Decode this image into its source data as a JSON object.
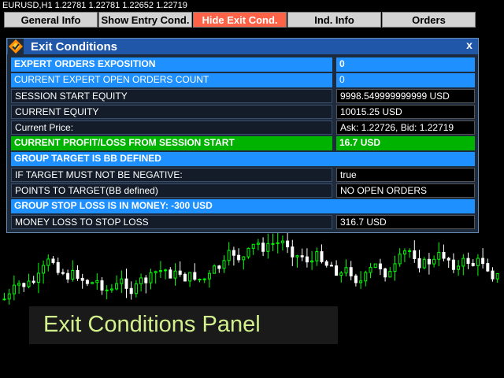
{
  "window": {
    "title": "EURUSD,H1  1.22781 1.22781 1.22652 1.22719"
  },
  "tabs": [
    {
      "label": "General Info",
      "active": false
    },
    {
      "label": "Show Entry Cond.",
      "active": false
    },
    {
      "label": "Hide Exit Cond.",
      "active": true
    },
    {
      "label": "Ind. Info",
      "active": false
    },
    {
      "label": "Orders",
      "active": false
    }
  ],
  "panel": {
    "title": "Exit Conditions",
    "close_label": "x",
    "logo_icon": "orange-diamond-logo-icon",
    "rows": {
      "expert_orders": {
        "label": "EXPERT ORDERS EXPOSITION",
        "value": "0"
      },
      "open_orders": {
        "label": "CURRENT EXPERT OPEN ORDERS COUNT",
        "value": "0"
      },
      "start_equity": {
        "label": "SESSION START EQUITY",
        "value": "9998.549999999999 USD"
      },
      "current_equity": {
        "label": "CURRENT EQUITY",
        "value": "10015.25 USD"
      },
      "current_price": {
        "label": "Current Price:",
        "value": "Ask: 1.22726, Bid: 1.22719"
      },
      "profit_loss": {
        "label": "CURRENT PROFIT/LOSS FROM SESSION START",
        "value": "16.7 USD"
      },
      "group_target": {
        "label": "GROUP TARGET IS BB DEFINED"
      },
      "target_not_negative": {
        "label": "IF TARGET MUST NOT BE NEGATIVE:",
        "value": "true"
      },
      "points_to_target": {
        "label": "POINTS TO TARGET(BB defined)",
        "value": "NO OPEN ORDERS"
      },
      "group_stop_loss": {
        "label": "GROUP STOP LOSS IS IN MONEY: -300 USD"
      },
      "money_loss": {
        "label": "MONEY LOSS TO STOP LOSS",
        "value": "316.7 USD"
      }
    }
  },
  "caption": "Exit Conditions Panel",
  "colors": {
    "bull_candle": "#00ff00",
    "bear_candle": "#ffffff",
    "accent_tab": "#ff6347",
    "section_blue": "#1e90ff",
    "profit_green": "#00b300",
    "header_blue": "#2157a9"
  }
}
